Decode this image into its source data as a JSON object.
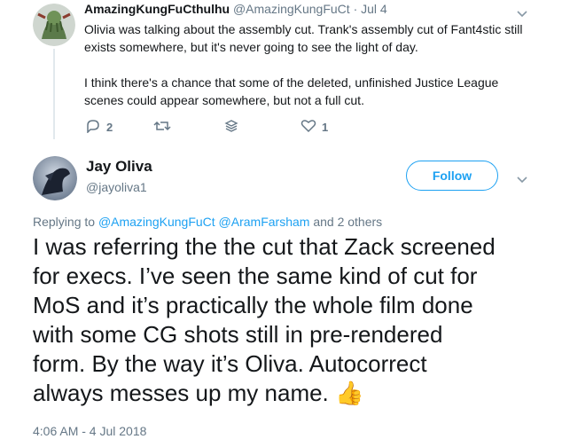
{
  "parent_tweet": {
    "display_name": "AmazingKungFuCthulhu",
    "handle": "@AmazingKungFuCt",
    "separator": "·",
    "date": "Jul 4",
    "lines": [
      "Olivia was talking about the assembly cut. Trank's assembly cut of Fant4stic still",
      "exists somewhere, but it's never going to see the light of day.",
      "I think there's a chance that some of the deleted, unfinished Justice League",
      "scenes could appear somewhere, but not a full cut."
    ],
    "actions": {
      "reply_count": "2",
      "retweet_count": "",
      "like_count": "1"
    }
  },
  "main_tweet": {
    "display_name": "Jay Oliva",
    "handle": "@jayoliva1",
    "follow_label": "Follow",
    "replying_prefix": "Replying to",
    "replying_mentions": "@AmazingKungFuCt @AramFarsham",
    "replying_suffix": "and 2 others",
    "text_lines": [
      "I was referring the the cut that Zack screened",
      "for execs. I’ve seen the same kind of cut for",
      "MoS and it’s practically the whole film done",
      "with some CG shots still in pre-rendered",
      "form. By the way it’s Oliva. Autocorrect",
      "always messes up my name. 👍"
    ],
    "timestamp": "4:06 AM - 4 Jul 2018"
  },
  "colors": {
    "accent": "#1da1f2",
    "muted": "#657786",
    "text": "#14171a",
    "divider": "#e1e8ed"
  }
}
